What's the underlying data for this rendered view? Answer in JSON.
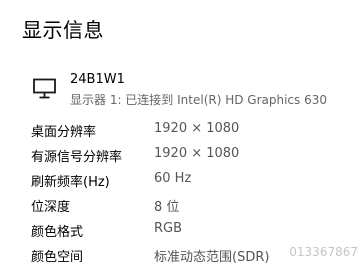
{
  "page": {
    "title": "显示信息"
  },
  "monitor": {
    "icon": "monitor-icon",
    "name": "24B1W1",
    "description": "显示器 1: 已连接到 Intel(R) HD Graphics 630"
  },
  "properties": [
    {
      "label": "桌面分辨率",
      "value": "1920 × 1080"
    },
    {
      "label": "有源信号分辨率",
      "value": "1920 × 1080"
    },
    {
      "label": "刷新频率(Hz)",
      "value": "60 Hz"
    },
    {
      "label": "位深度",
      "value": "8 位"
    },
    {
      "label": "颜色格式",
      "value": "RGB"
    },
    {
      "label": "颜色空间",
      "value": "标准动态范围(SDR)"
    }
  ],
  "watermark": "013367867"
}
